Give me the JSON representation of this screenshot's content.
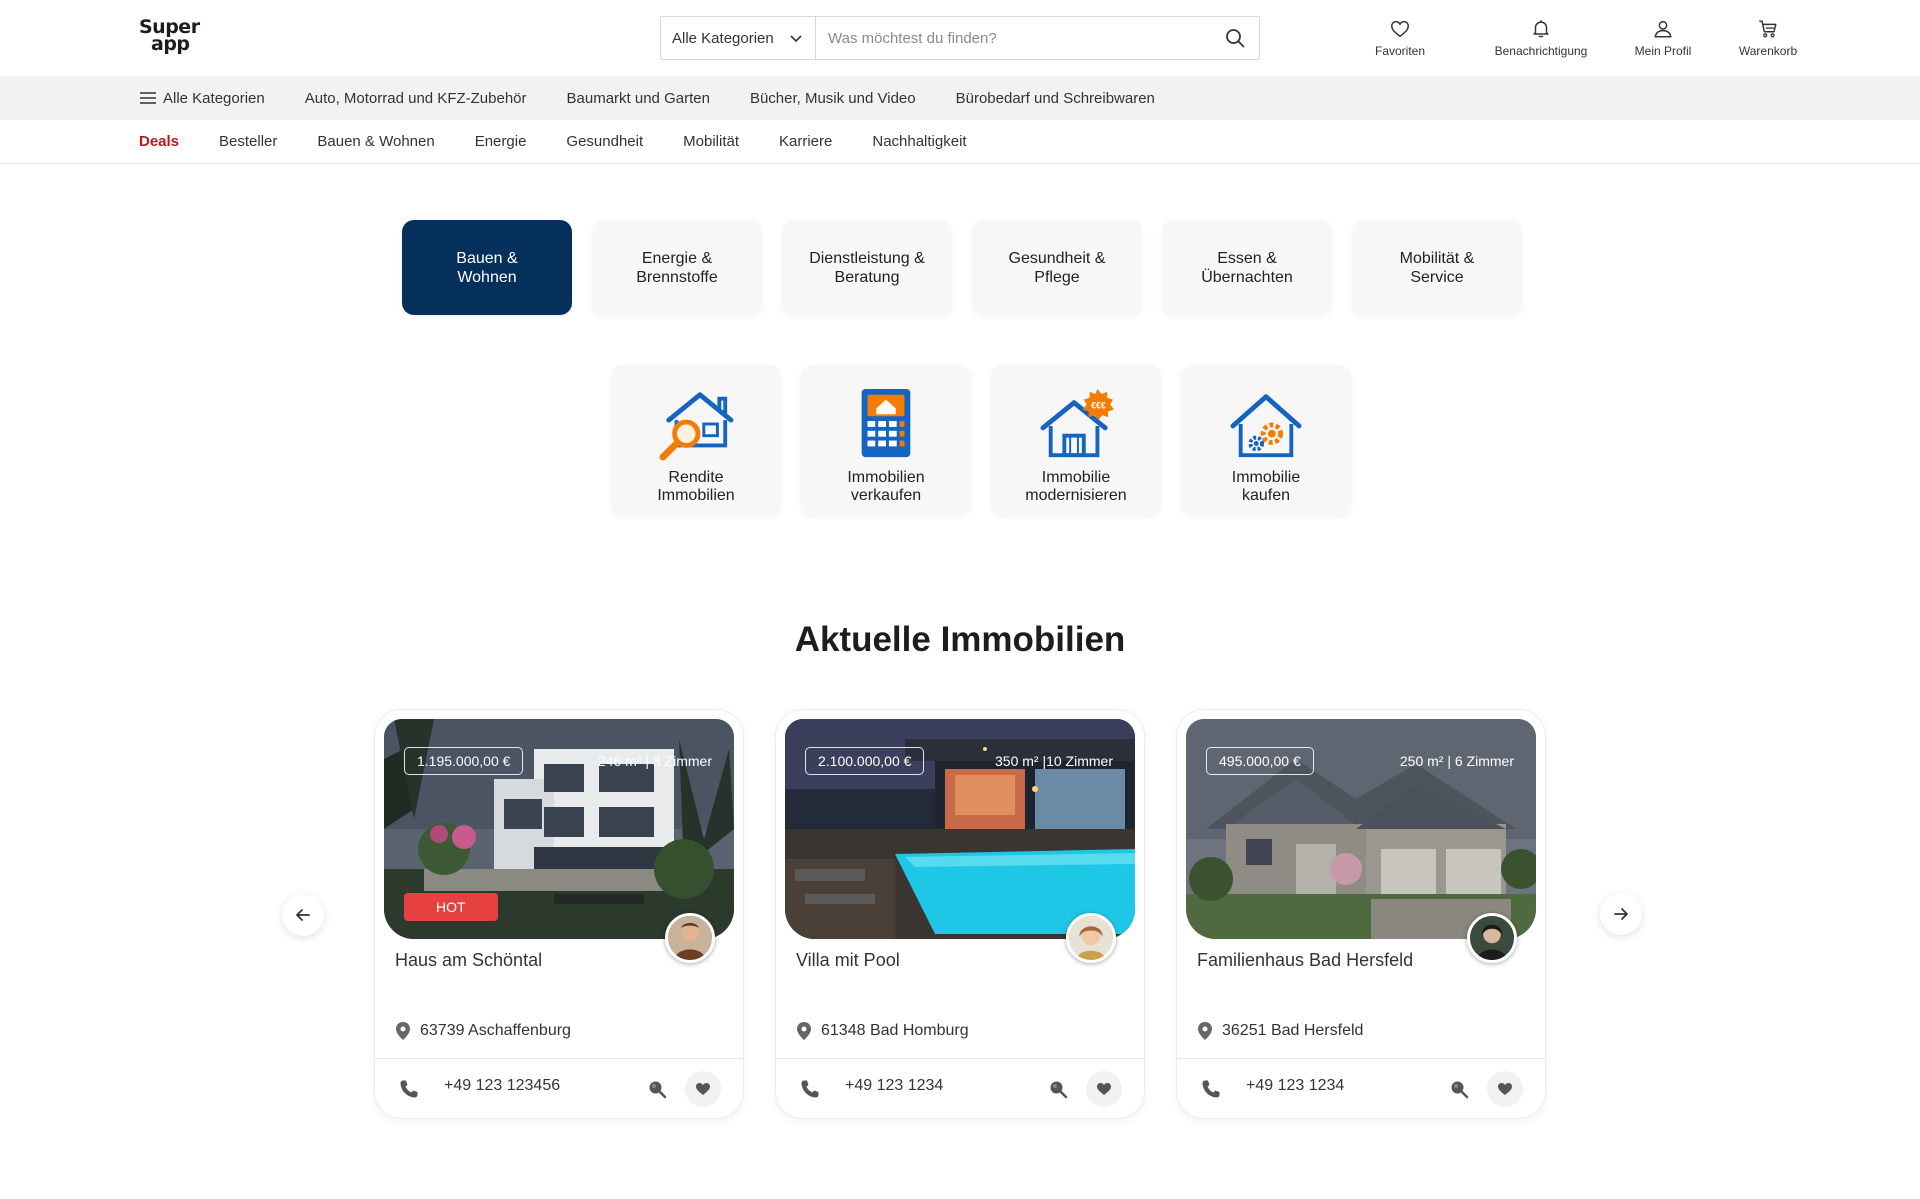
{
  "logo": {
    "line1": "Super",
    "line2": "app"
  },
  "search": {
    "category": "Alle Kategorien",
    "placeholder": "Was möchtest du finden?"
  },
  "header_icons": [
    {
      "label": "Favoriten",
      "icon": "heart-icon"
    },
    {
      "label": "Benachrichtigung",
      "icon": "bell-icon"
    },
    {
      "label": "Mein Profil",
      "icon": "user-icon"
    },
    {
      "label": "Warenkorb",
      "icon": "cart-icon"
    }
  ],
  "category_bar": [
    "Alle Kategorien",
    "Auto, Motorrad und KFZ-Zubehör",
    "Baumarkt und Garten",
    "Bücher, Musik und Video",
    "Bürobedarf und Schreibwaren"
  ],
  "tabs": [
    "Deals",
    "Besteller",
    "Bauen & Wohnen",
    "Energie",
    "Gesundheit",
    "Mobilität",
    "Karriere",
    "Nachhaltigkeit"
  ],
  "active_tab": "Deals",
  "category_tiles": [
    {
      "line1": "Bauen &",
      "line2": "Wohnen",
      "active": true
    },
    {
      "line1": "Energie &",
      "line2": "Brennstoffe"
    },
    {
      "line1": "Dienstleistung &",
      "line2": "Beratung"
    },
    {
      "line1": "Gesundheit &",
      "line2": "Pflege"
    },
    {
      "line1": "Essen &",
      "line2": "Übernachten"
    },
    {
      "line1": "Mobilität &",
      "line2": "Service"
    }
  ],
  "sub_tiles": [
    {
      "line1": "Rendite",
      "line2": "Immobilien",
      "icon": "house-search-icon"
    },
    {
      "line1": "Immobilien",
      "line2": "verkaufen",
      "icon": "calculator-house-icon"
    },
    {
      "line1": "Immobilie",
      "line2": "modernisieren",
      "icon": "house-euro-icon",
      "badge": "€€€"
    },
    {
      "line1": "Immobilie",
      "line2": "kaufen",
      "icon": "house-gears-icon"
    }
  ],
  "section_title": "Aktuelle Immobilien",
  "listings": [
    {
      "price": "1.195.000,00 €",
      "meta": "246 m² | 8 Zimmer",
      "badge": "HOT",
      "title": "Haus am Schöntal",
      "location": "63739 Aschaffenburg",
      "phone": "+49 123 123456"
    },
    {
      "price": "2.100.000,00 €",
      "meta": "350  m² |10 Zimmer",
      "title": "Villa mit Pool",
      "location": "61348 Bad Homburg",
      "phone": "+49 123 1234"
    },
    {
      "price": "495.000,00 €",
      "meta": "250 m² | 6 Zimmer",
      "title": "Familienhaus Bad Hersfeld",
      "location": "36251 Bad Hersfeld",
      "phone": "+49 123 1234"
    }
  ],
  "colors": {
    "accent": "#06305c",
    "deal_red": "#c4161c",
    "hot_red": "#e74040",
    "icon_blue": "#1565c0",
    "icon_orange": "#f57c00"
  }
}
